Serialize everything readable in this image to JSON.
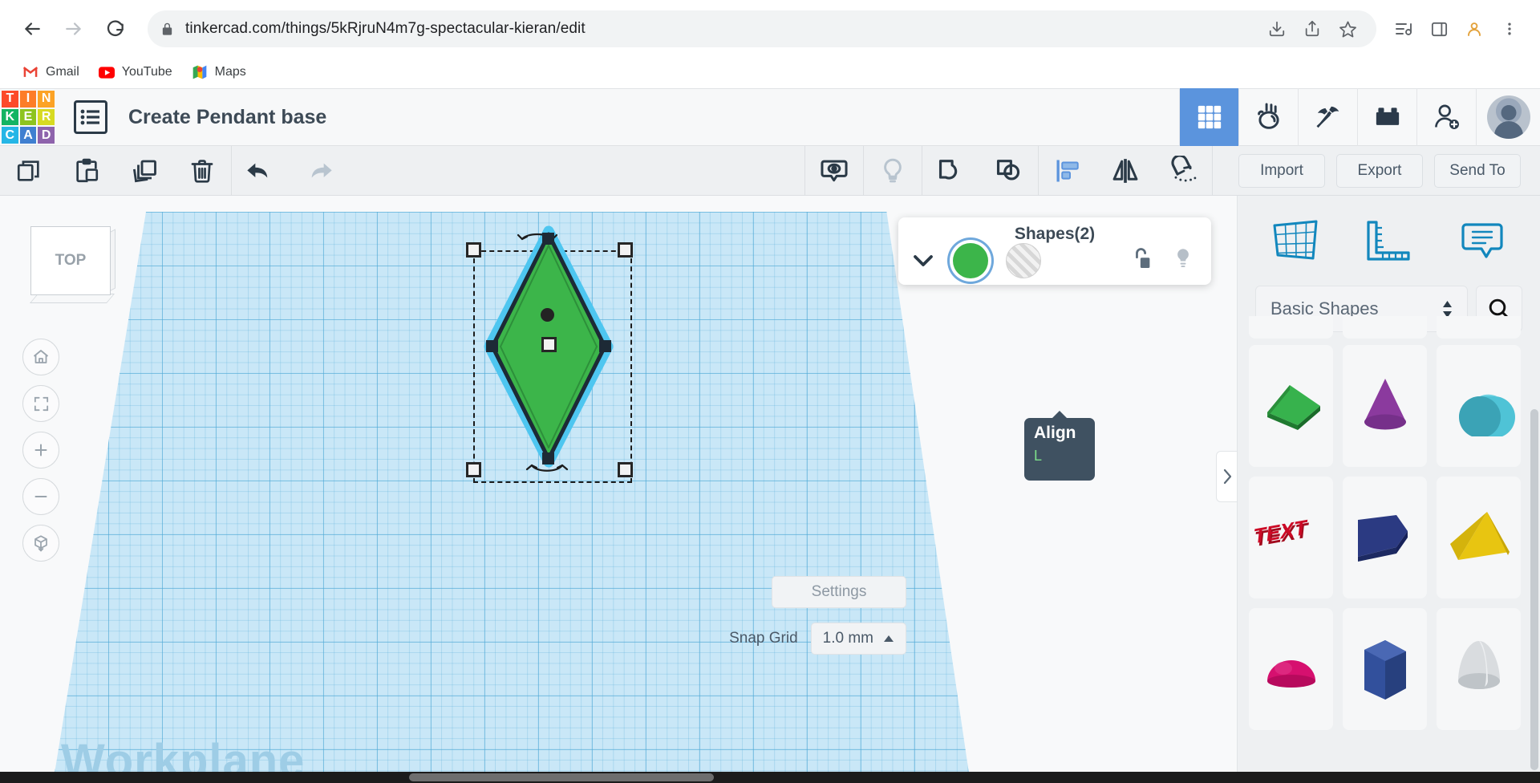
{
  "browser": {
    "back_icon": "back-arrow-icon",
    "forward_icon": "forward-arrow-icon",
    "reload_icon": "reload-icon",
    "lock_icon": "lock-icon",
    "url": "tinkercad.com/things/5kRjruN4m7g-spectacular-kieran/edit",
    "right_icons": [
      "download-icon",
      "share-icon",
      "bookmark-star-icon",
      "media-list-icon",
      "side-panel-icon",
      "profile-icon",
      "chrome-menu-icon"
    ],
    "bookmarks": [
      {
        "label": "Gmail",
        "icon": "gmail-icon"
      },
      {
        "label": "YouTube",
        "icon": "youtube-icon"
      },
      {
        "label": "Maps",
        "icon": "maps-icon"
      }
    ]
  },
  "tinkercad_header": {
    "logo_tiles": [
      {
        "letter": "T",
        "color": "#fc4a2a"
      },
      {
        "letter": "I",
        "color": "#fd7d28"
      },
      {
        "letter": "N",
        "color": "#fca326"
      },
      {
        "letter": "K",
        "color": "#13b463"
      },
      {
        "letter": "E",
        "color": "#8dc41f"
      },
      {
        "letter": "R",
        "color": "#d7da22"
      },
      {
        "letter": "C",
        "color": "#25b6e6"
      },
      {
        "letter": "A",
        "color": "#3f7fd0"
      },
      {
        "letter": "D",
        "color": "#8e63ac"
      }
    ],
    "menu_icon": "project-list-icon",
    "title": "Create Pendant base",
    "right_icons": [
      {
        "name": "grid-apps-icon",
        "active": true
      },
      {
        "name": "circuits-hand-icon",
        "active": false
      },
      {
        "name": "minecraft-pickaxe-icon",
        "active": false
      },
      {
        "name": "lego-brick-icon",
        "active": false
      },
      {
        "name": "invite-person-icon",
        "active": false
      }
    ],
    "avatar": "user-avatar"
  },
  "toolbar": {
    "left_tools": [
      {
        "name": "copy-button",
        "icon": "copy-icon",
        "state": "enabled"
      },
      {
        "name": "paste-button",
        "icon": "paste-icon",
        "state": "enabled"
      },
      {
        "name": "duplicate-button",
        "icon": "duplicate-icon",
        "state": "enabled"
      },
      {
        "name": "delete-button",
        "icon": "trash-icon",
        "state": "enabled"
      },
      {
        "name": "undo-button",
        "icon": "undo-arrow-icon",
        "state": "enabled"
      },
      {
        "name": "redo-button",
        "icon": "redo-arrow-icon",
        "state": "disabled"
      }
    ],
    "right_tools": [
      {
        "name": "show-hide-button",
        "icon": "eye-visibility-icon",
        "state": "enabled"
      },
      {
        "name": "hint-button",
        "icon": "lightbulb-icon",
        "state": "disabled"
      },
      {
        "name": "group-button",
        "icon": "group-shapes-icon",
        "state": "enabled"
      },
      {
        "name": "ungroup-button",
        "icon": "ungroup-shapes-icon",
        "state": "enabled"
      },
      {
        "name": "align-button",
        "icon": "align-icon",
        "state": "active"
      },
      {
        "name": "mirror-button",
        "icon": "mirror-flip-icon",
        "state": "enabled"
      },
      {
        "name": "snap-magnet-button",
        "icon": "magnet-snap-icon",
        "state": "enabled"
      }
    ],
    "import_label": "Import",
    "export_label": "Export",
    "send_to_label": "Send To"
  },
  "tooltip": {
    "title": "Align",
    "shortcut": "L",
    "accent_color": "#7de08a"
  },
  "shapes_panel": {
    "title": "Shapes(2)",
    "collapse_icon": "chevron-down-icon",
    "solid_swatch": "solid-green-swatch",
    "solid_color": "#3cb54a",
    "hole_swatch": "hole-hatched-swatch",
    "lock_icon": "unlock-icon",
    "light_icon": "lightbulb-icon"
  },
  "canvas": {
    "viewcube_face": "TOP",
    "workplane_label": "Workplane",
    "view_controls": [
      {
        "name": "home-view-button",
        "icon": "home-icon"
      },
      {
        "name": "fit-to-view-button",
        "icon": "fit-frame-icon"
      },
      {
        "name": "zoom-in-button",
        "icon": "plus-icon"
      },
      {
        "name": "zoom-out-button",
        "icon": "minus-icon"
      },
      {
        "name": "perspective-toggle-button",
        "icon": "ortho-cube-icon"
      }
    ],
    "selected_shape": {
      "name": "green-diamond-shape",
      "fill": "#3cb54a",
      "highlight": "#4ec6f0"
    },
    "collapse_panel_icon": "chevron-right-icon",
    "settings_label": "Settings",
    "snap_grid_label": "Snap Grid",
    "snap_grid_value": "1.0 mm",
    "snap_grid_caret": "caret-up-icon"
  },
  "sidebar": {
    "mode_icons": [
      {
        "name": "workplane-tool-icon"
      },
      {
        "name": "ruler-tool-icon"
      },
      {
        "name": "notes-tool-icon"
      }
    ],
    "category_value": "Basic Shapes",
    "category_spinner": "spinner-up-down-icon",
    "search_icon": "search-icon",
    "shapes": [
      {
        "name": "roof-wedge-shape",
        "color": "#2f9e3f",
        "glyph": "wedge"
      },
      {
        "name": "cone-shape",
        "color": "#8b3a9e",
        "glyph": "cone"
      },
      {
        "name": "half-cylinder-shape",
        "color": "#43b0c4",
        "glyph": "halfcyl"
      },
      {
        "name": "text-shape",
        "color": "#cc0a26",
        "glyph": "text"
      },
      {
        "name": "polygon-box-shape",
        "color": "#2b3a82",
        "glyph": "box"
      },
      {
        "name": "pyramid-shape",
        "color": "#e8c511",
        "glyph": "pyramid"
      },
      {
        "name": "half-sphere-shape",
        "color": "#d6106f",
        "glyph": "dome"
      },
      {
        "name": "hex-prism-shape",
        "color": "#32509c",
        "glyph": "hex"
      },
      {
        "name": "paraboloid-shape",
        "color": "#cdd1d4",
        "glyph": "para"
      }
    ]
  }
}
